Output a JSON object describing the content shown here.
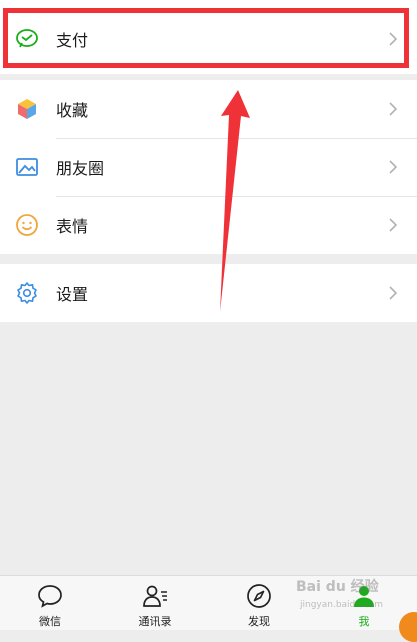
{
  "menu": {
    "payment": {
      "label": "支付",
      "icon": "wallet-icon"
    },
    "favorites": {
      "label": "收藏",
      "icon": "cube-icon"
    },
    "moments": {
      "label": "朋友圈",
      "icon": "photo-icon"
    },
    "stickers": {
      "label": "表情",
      "icon": "smiley-icon"
    },
    "settings": {
      "label": "设置",
      "icon": "gear-icon"
    }
  },
  "tabbar": {
    "chats": "微信",
    "contacts": "通讯录",
    "discover": "发现",
    "me": "我"
  },
  "watermark": {
    "text": "Bai du 经验",
    "sub": "jingyan.baidu.com"
  },
  "colors": {
    "highlight": "#ef3138",
    "accent_green": "#1aad19",
    "background": "#ededed"
  }
}
